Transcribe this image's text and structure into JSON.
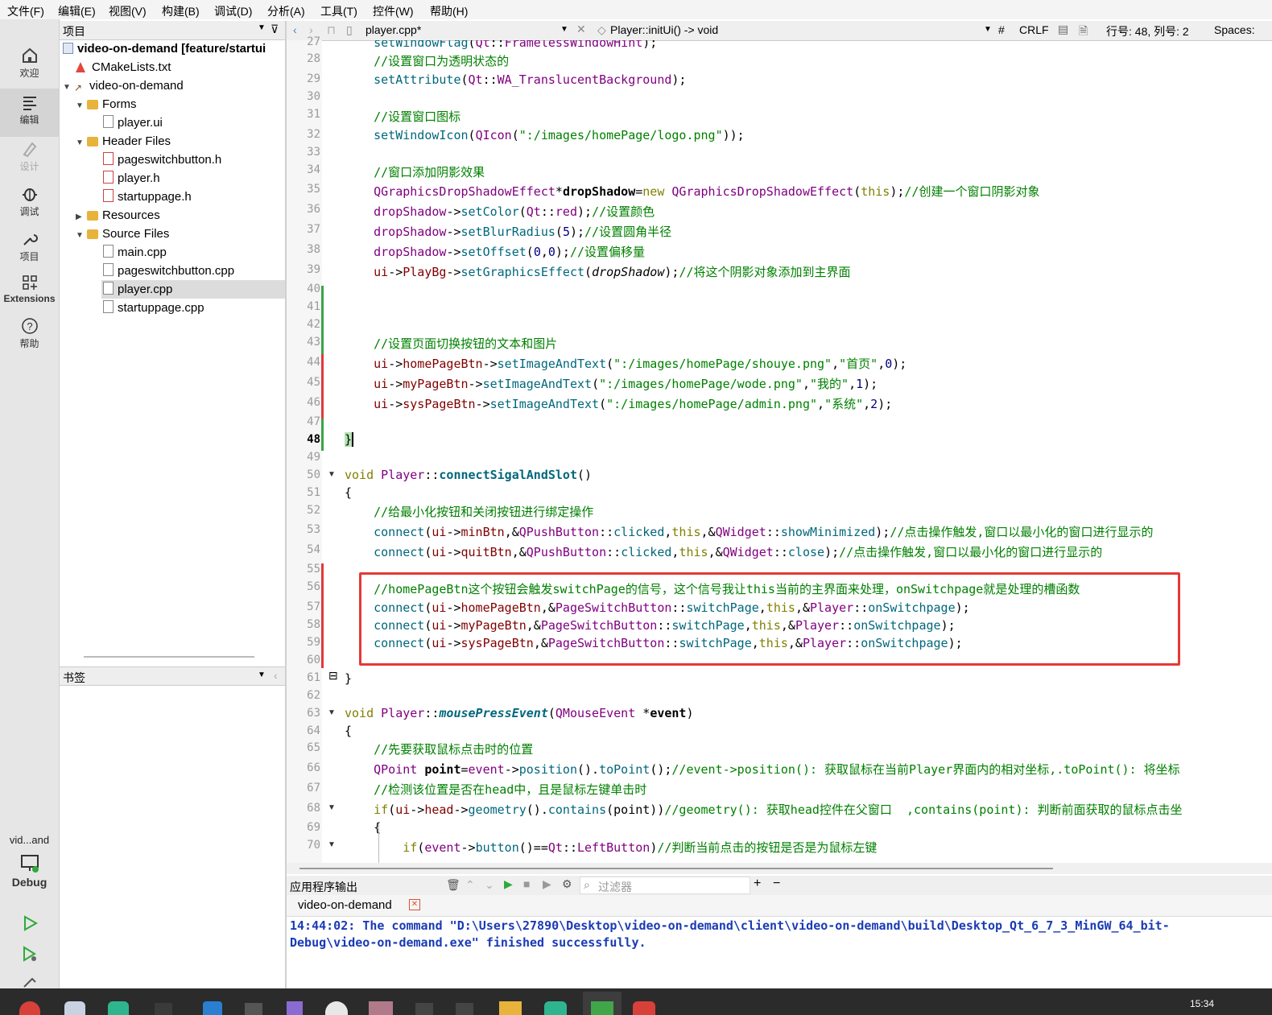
{
  "menu": [
    "文件(F)",
    "编辑(E)",
    "视图(V)",
    "构建(B)",
    "调试(D)",
    "分析(A)",
    "工具(T)",
    "控件(W)",
    "帮助(H)"
  ],
  "modes": [
    {
      "label": "欢迎",
      "icon": "home-icon"
    },
    {
      "label": "编辑",
      "icon": "edit-icon"
    },
    {
      "label": "设计",
      "icon": "design-icon"
    },
    {
      "label": "调试",
      "icon": "debug-icon"
    },
    {
      "label": "项目",
      "icon": "project-icon"
    },
    {
      "label": "Extensions",
      "icon": "extensions-icon"
    },
    {
      "label": "帮助",
      "icon": "help-icon"
    }
  ],
  "kit": {
    "name": "vid...and",
    "config": "Debug"
  },
  "project_panel": {
    "title": "项目",
    "tree": [
      {
        "label": "video-on-demand [feature/startui"
      },
      {
        "label": "CMakeLists.txt"
      },
      {
        "label": "video-on-demand"
      },
      {
        "label": "Forms"
      },
      {
        "label": "player.ui"
      },
      {
        "label": "Header Files"
      },
      {
        "label": "pageswitchbutton.h"
      },
      {
        "label": "player.h"
      },
      {
        "label": "startuppage.h"
      },
      {
        "label": "Resources"
      },
      {
        "label": "Source Files"
      },
      {
        "label": "main.cpp"
      },
      {
        "label": "pageswitchbutton.cpp"
      },
      {
        "label": "player.cpp"
      },
      {
        "label": "startuppage.cpp"
      }
    ]
  },
  "bookmarks_panel": {
    "title": "书签"
  },
  "editor": {
    "file_tab": "player.cpp*",
    "function": "Player::initUi() -> void",
    "hash": "#",
    "line_ending": "CRLF",
    "position": "行号: 48, 列号: 2",
    "spaces": "Spaces:"
  },
  "line_numbers": [
    "27",
    "28",
    "29",
    "30",
    "31",
    "32",
    "33",
    "34",
    "35",
    "36",
    "37",
    "38",
    "39",
    "40",
    "41",
    "42",
    "43",
    "44",
    "45",
    "46",
    "47",
    "48",
    "49",
    "50",
    "51",
    "52",
    "53",
    "54",
    "55",
    "56",
    "57",
    "58",
    "59",
    "60",
    "61",
    "62",
    "63",
    "64",
    "65",
    "66",
    "67",
    "68",
    "69",
    "70"
  ],
  "output": {
    "title": "应用程序输出",
    "filter_placeholder": "过滤器",
    "tab": "video-on-demand",
    "lines": [
      "14:44:02: The command \"D:\\Users\\27890\\Desktop\\video-on-demand\\client\\video-on-demand\\build\\Desktop_Qt_6_7_3_MinGW_64_bit-",
      "Debug\\video-on-demand.exe\" finished successfully."
    ]
  },
  "taskbar": {
    "time": "15:34"
  },
  "colors": {
    "highlight_box": "#e53935",
    "keyword": "#808000",
    "comment": "#008000",
    "type": "#800080"
  }
}
